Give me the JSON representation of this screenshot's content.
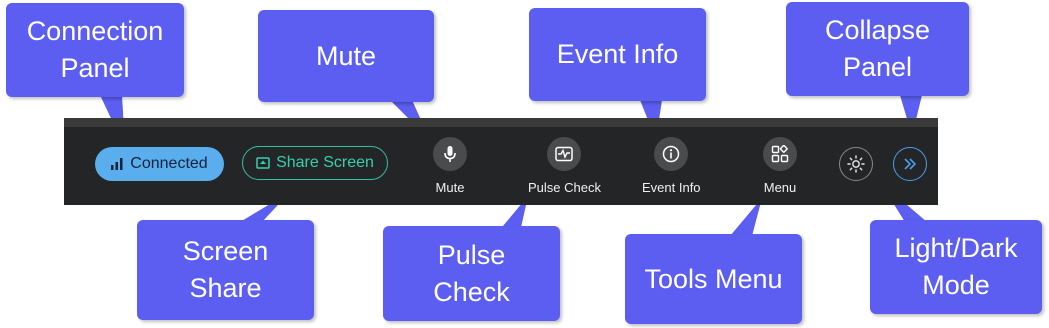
{
  "toolbar": {
    "connected_label": "Connected",
    "share_label": "Share Screen",
    "tools": [
      {
        "label": "Mute",
        "icon": "microphone-icon"
      },
      {
        "label": "Pulse Check",
        "icon": "pulse-check-icon"
      },
      {
        "label": "Event Info",
        "icon": "info-icon"
      },
      {
        "label": "Menu",
        "icon": "tools-menu-icon"
      }
    ],
    "theme_icon": "sun-icon",
    "collapse_icon": "chevron-double-right-icon"
  },
  "callouts": {
    "connection_panel": "Connection Panel",
    "mute": "Mute",
    "event_info": "Event Info",
    "collapse_panel": "Collapse Panel",
    "screen_share": "Screen Share",
    "pulse_check": "Pulse Check",
    "tools_menu": "Tools Menu",
    "light_dark_mode": "Light/Dark Mode"
  },
  "colors": {
    "callout": "#5b5ef0",
    "toolbar_bg": "#242526",
    "connected_bg": "#5aaeee",
    "share_accent": "#2fc1a6",
    "collapse_accent": "#4a9fe8"
  }
}
